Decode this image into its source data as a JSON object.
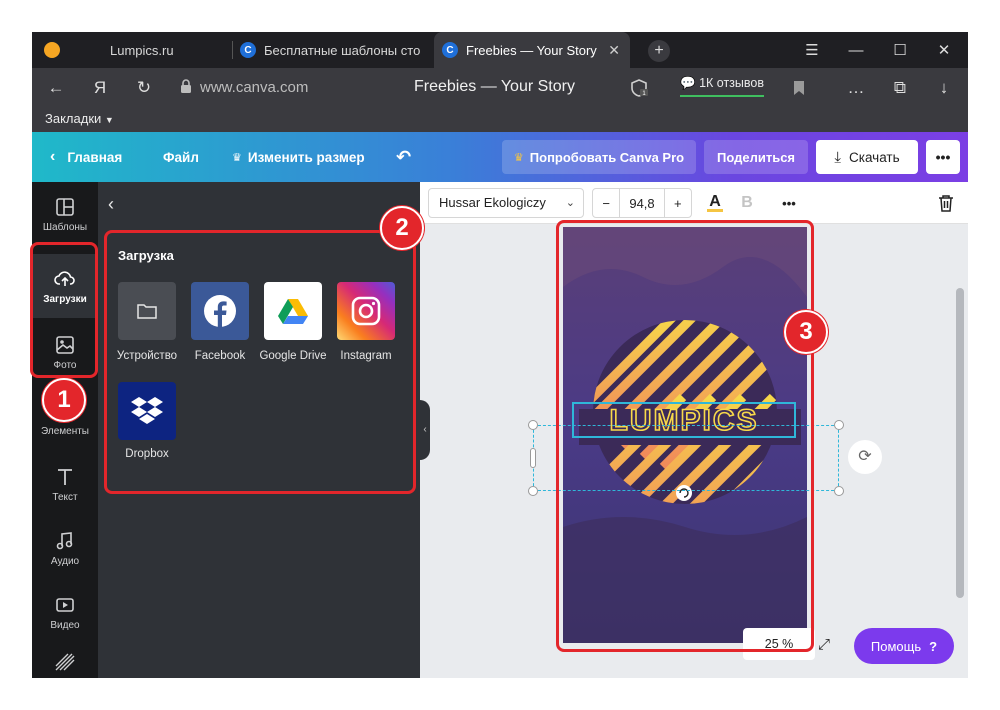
{
  "browser": {
    "tabs": [
      {
        "label": "Lumpics.ru",
        "favicon": "orange-dot-icon"
      },
      {
        "label": "Бесплатные шаблоны сто",
        "favicon": "canva-icon"
      },
      {
        "label": "Freebies — Your Story",
        "favicon": "canva-icon",
        "active": true
      }
    ],
    "url": "www.canva.com",
    "page_title": "Freebies — Your Story",
    "reviews": "1К отзывов",
    "bookmarks_label": "Закладки",
    "ya_label": "Я"
  },
  "canva_header": {
    "home": "Главная",
    "file": "Файл",
    "resize": "Изменить размер",
    "try_pro": "Попробовать Canva Pro",
    "share": "Поделиться",
    "download": "Скачать"
  },
  "sidenav": {
    "items": [
      {
        "label": "Шаблоны",
        "icon": "templates-icon"
      },
      {
        "label": "Загрузки",
        "icon": "upload-cloud-icon",
        "selected": true
      },
      {
        "label": "Фото",
        "icon": "photo-icon"
      },
      {
        "label": "Элементы",
        "icon": "elements-icon"
      },
      {
        "label": "Текст",
        "icon": "text-icon"
      },
      {
        "label": "Аудио",
        "icon": "music-icon"
      },
      {
        "label": "Видео",
        "icon": "video-icon"
      }
    ]
  },
  "uploads_panel": {
    "title": "Загрузка",
    "sources": [
      {
        "label": "Устройство",
        "icon": "folder-icon"
      },
      {
        "label": "Facebook",
        "icon": "facebook-icon"
      },
      {
        "label": "Google Drive",
        "icon": "google-drive-icon"
      },
      {
        "label": "Instagram",
        "icon": "instagram-icon"
      },
      {
        "label": "Dropbox",
        "icon": "dropbox-icon"
      }
    ]
  },
  "editor_toolbar": {
    "font": "Hussar Ekologiczy",
    "font_size": "94,8",
    "minus": "−",
    "plus": "+",
    "text_color_label": "A",
    "bold_label": "B",
    "more": "•••"
  },
  "canvas": {
    "text": "LUMPICS",
    "zoom": "25 %",
    "help": "Помощь",
    "help_mark": "?"
  },
  "annotations": [
    "1",
    "2",
    "3"
  ],
  "colors": {
    "accent_red": "#e3262b",
    "canva_purple": "#7c3aed",
    "panel_bg": "#2f3237"
  }
}
